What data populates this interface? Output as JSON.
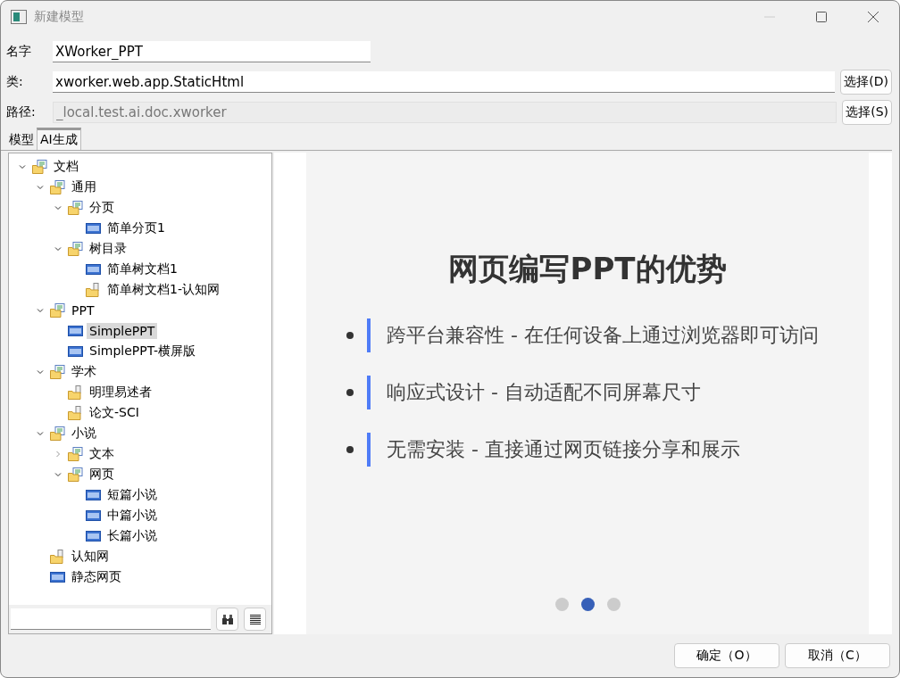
{
  "window": {
    "title": "新建模型"
  },
  "form": [
    {
      "label": "名字",
      "value": "XWorker_PPT",
      "disabled": false
    },
    {
      "label": "类:",
      "value": "xworker.web.app.StaticHtml",
      "disabled": false,
      "button": "选择(D)"
    },
    {
      "label": "路径:",
      "value": "_local.test.ai.doc.xworker",
      "disabled": true,
      "button": "选择(S)"
    }
  ],
  "tabs": [
    {
      "label": "模型",
      "selected": false
    },
    {
      "label": "AI生成",
      "selected": true
    }
  ],
  "tree": [
    {
      "label": "文档",
      "kind": "category",
      "expanded": true,
      "selected": false,
      "children": [
        {
          "label": "通用",
          "kind": "category",
          "expanded": true,
          "selected": false,
          "children": [
            {
              "label": "分页",
              "kind": "category",
              "expanded": true,
              "selected": false,
              "children": [
                {
                  "label": "简单分页1",
                  "kind": "page",
                  "selected": false
                }
              ]
            },
            {
              "label": "树目录",
              "kind": "category",
              "expanded": true,
              "selected": false,
              "children": [
                {
                  "label": "简单树文档1",
                  "kind": "page",
                  "selected": false
                },
                {
                  "label": "简单树文档1-认知网",
                  "kind": "folder",
                  "selected": false
                }
              ]
            }
          ]
        },
        {
          "label": "PPT",
          "kind": "category",
          "expanded": true,
          "selected": false,
          "children": [
            {
              "label": "SimplePPT",
              "kind": "page",
              "selected": true
            },
            {
              "label": "SimplePPT-横屏版",
              "kind": "page",
              "selected": false
            }
          ]
        },
        {
          "label": "学术",
          "kind": "category",
          "expanded": true,
          "selected": false,
          "children": [
            {
              "label": "明理易述者",
              "kind": "folder",
              "selected": false
            },
            {
              "label": "论文-SCI",
              "kind": "folder",
              "selected": false
            }
          ]
        },
        {
          "label": "小说",
          "kind": "category",
          "expanded": true,
          "selected": false,
          "children": [
            {
              "label": "文本",
              "kind": "category",
              "expanded": false,
              "selected": false
            },
            {
              "label": "网页",
              "kind": "category",
              "expanded": true,
              "selected": false,
              "children": [
                {
                  "label": "短篇小说",
                  "kind": "page",
                  "selected": false
                },
                {
                  "label": "中篇小说",
                  "kind": "page",
                  "selected": false
                },
                {
                  "label": "长篇小说",
                  "kind": "page",
                  "selected": false
                }
              ]
            }
          ]
        },
        {
          "label": "认知网",
          "kind": "folder",
          "selected": false
        },
        {
          "label": "静态网页",
          "kind": "page",
          "selected": false
        }
      ]
    }
  ],
  "slide": {
    "title": "网页编写PPT的优势",
    "bullets": [
      "跨平台兼容性 - 在任何设备上通过浏览器即可访问",
      "响应式设计 - 自动适配不同屏幕尺寸",
      "无需安装 - 直接通过网页链接分享和展示"
    ],
    "dots": [
      {
        "selected": false
      },
      {
        "selected": true
      },
      {
        "selected": false
      }
    ]
  },
  "buttons": [
    "确定（O）",
    "取消（C）"
  ]
}
